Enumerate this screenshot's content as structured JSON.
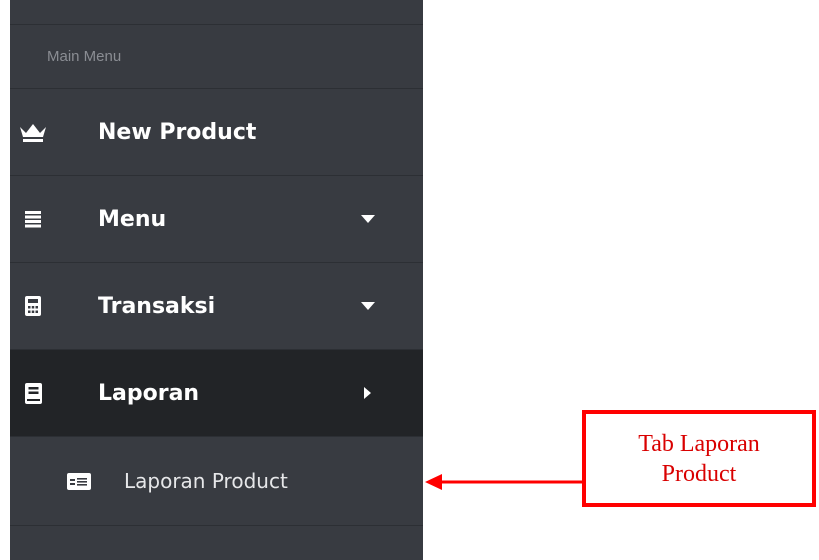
{
  "sidebar": {
    "section_header": "Main Menu",
    "items": [
      {
        "label": "New Product",
        "icon": "crown-icon",
        "has_caret": false
      },
      {
        "label": "Menu",
        "icon": "list-icon",
        "caret": "caret-down-icon"
      },
      {
        "label": "Transaksi",
        "icon": "calculator-icon",
        "caret": "caret-down-icon"
      },
      {
        "label": "Laporan",
        "icon": "book-icon",
        "caret": "caret-right-icon",
        "active": true
      }
    ],
    "sub_items": [
      {
        "label": "Laporan Product",
        "icon": "id-card-icon"
      }
    ]
  },
  "annotation": {
    "line1": "Tab Laporan",
    "line2": "Product",
    "color": "#ff0000"
  },
  "colors": {
    "sidebar_bg": "#383b41",
    "active_bg": "#222427",
    "text": "#ffffff",
    "header_text": "#8a8d93"
  }
}
